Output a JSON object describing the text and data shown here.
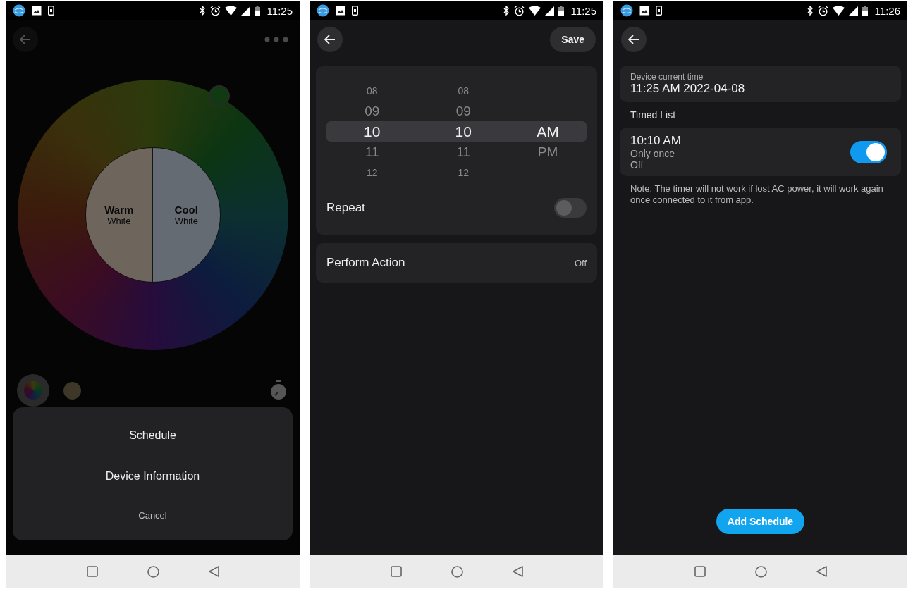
{
  "screens": [
    {
      "kind": "color",
      "status_bar": {
        "time": "11:25"
      },
      "wheel": {
        "warm_label": "Warm",
        "warm_sub": "White",
        "cool_label": "Cool",
        "cool_sub": "White"
      },
      "sheet": {
        "items": [
          "Schedule",
          "Device Information"
        ],
        "cancel": "Cancel"
      }
    },
    {
      "kind": "timer",
      "status_bar": {
        "time": "11:25"
      },
      "save": "Save",
      "picker": {
        "hours": [
          {
            "label": "08",
            "selected": false
          },
          {
            "label": "09",
            "selected": false
          },
          {
            "label": "10",
            "selected": true
          },
          {
            "label": "11",
            "selected": false
          },
          {
            "label": "12",
            "selected": false
          }
        ],
        "minutes": [
          {
            "label": "08",
            "selected": false
          },
          {
            "label": "09",
            "selected": false
          },
          {
            "label": "10",
            "selected": true
          },
          {
            "label": "11",
            "selected": false
          },
          {
            "label": "12",
            "selected": false
          }
        ],
        "periods": [
          {
            "label": "AM",
            "selected": true
          },
          {
            "label": "PM",
            "selected": false
          }
        ]
      },
      "repeat": {
        "label": "Repeat",
        "on": false
      },
      "action": {
        "label": "Perform Action",
        "value": "Off"
      }
    },
    {
      "kind": "schedule",
      "status_bar": {
        "time": "11:26"
      },
      "current_time": {
        "label": "Device current time",
        "value": "11:25 AM 2022-04-08"
      },
      "section": "Timed List",
      "timers": [
        {
          "time": "10:10 AM",
          "repeat": "Only once",
          "action": "Off",
          "on": true
        }
      ],
      "note": "Note: The timer will not work if lost AC power, it will work again once connected to it from app.",
      "add_button": "Add Schedule"
    }
  ]
}
